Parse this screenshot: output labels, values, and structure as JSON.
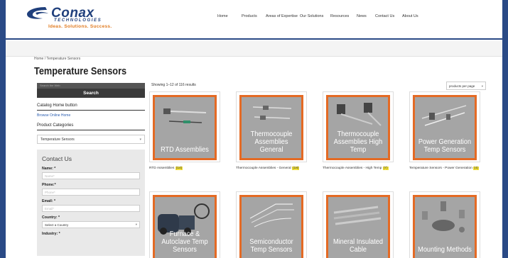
{
  "brand": {
    "name": "Conax",
    "sub": "TECHNOLOGIES",
    "tagline": "Ideas. Solutions. Success."
  },
  "nav": [
    "Home",
    "Products",
    "Areas of Expertise",
    "Our Solutions",
    "Resources",
    "News",
    "Contact Us",
    "About Us"
  ],
  "breadcrumb": "Home / Temperature Sensors",
  "page_title": "Temperature Sensors",
  "sidebar": {
    "search_placeholder": "Search the Web",
    "search_button": "Search",
    "catalog_heading": "Catalog Home button",
    "browse_link": "Browse Online Home",
    "categories_heading": "Product Categories",
    "category_selected": "Temperature Sensors",
    "contact": {
      "title": "Contact Us",
      "name_label": "Name: *",
      "name_placeholder": "Name*",
      "phone_label": "Phone:*",
      "phone_placeholder": "Phone*",
      "email_label": "Email: *",
      "email_placeholder": "Email*",
      "country_label": "Country: *",
      "country_selected": "Select a Country",
      "industry_label": "Industry: *"
    }
  },
  "results_text": "Showing 1–12 of 116 results",
  "per_page_label": "products per page",
  "products": [
    {
      "title": "RTD Assemblies",
      "caption": "RTD Assemblies",
      "count": "(14)"
    },
    {
      "title": "Thermocouple Assemblies General",
      "caption": "Thermocouple Assemblies - General",
      "count": "(18)"
    },
    {
      "title": "Thermocouple Assemblies High Temp",
      "caption": "Thermocouple Assemblies - High Temp",
      "count": "(7)"
    },
    {
      "title": "Power Generation Temp Sensors",
      "caption": "Temperature Sensors - Power Generation",
      "count": "(4)"
    },
    {
      "title": "Furnace & Autoclave Temp Sensors"
    },
    {
      "title": "Semiconductor Temp Sensors"
    },
    {
      "title": "Mineral Insulated Cable"
    },
    {
      "title": "Mounting Methods"
    }
  ],
  "colors": {
    "brand_blue": "#1f3f7c",
    "accent_orange": "#e46a24",
    "badge_yellow": "#f4e23a"
  }
}
